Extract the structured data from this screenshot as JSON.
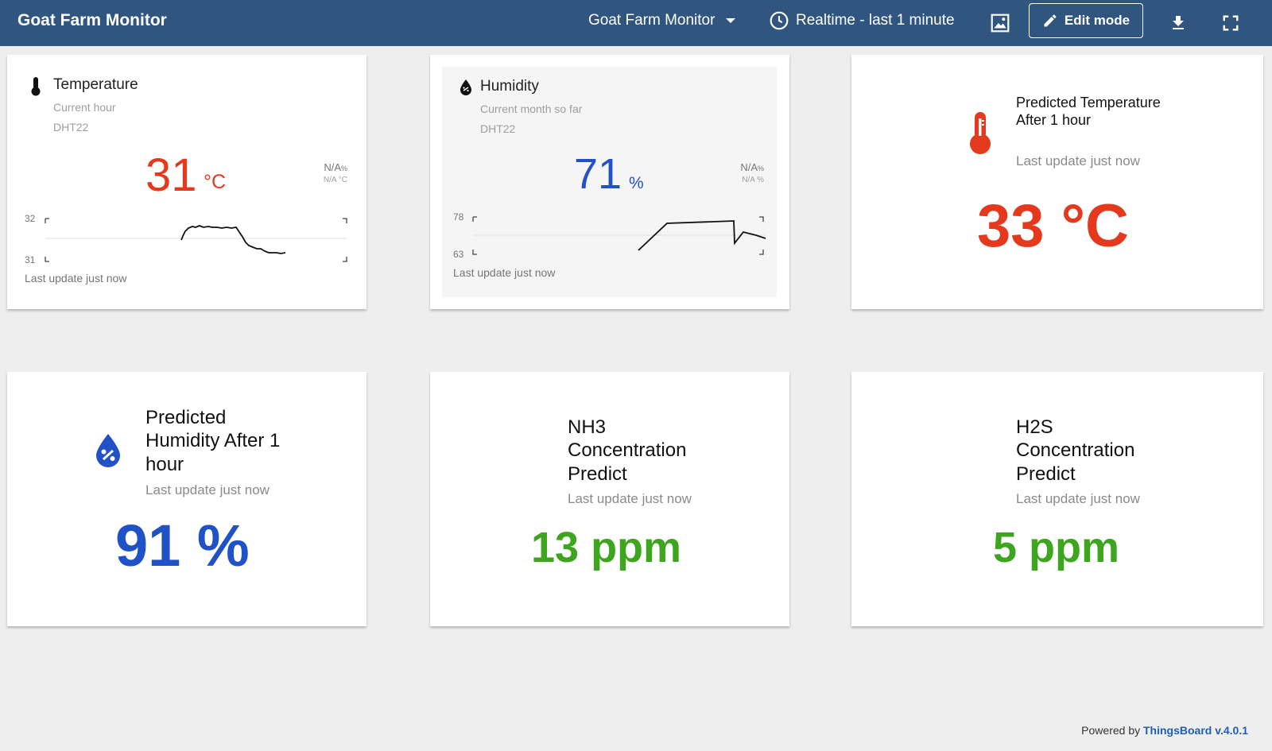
{
  "header": {
    "title": "Goat Farm Monitor",
    "dashboard_select": "Goat Farm Monitor",
    "time_window": "Realtime - last 1 minute",
    "edit_mode_label": "Edit mode",
    "icons": [
      "image-icon",
      "download-icon",
      "fullscreen-icon"
    ]
  },
  "colors": {
    "header_bg": "#305680",
    "temperature": "#e5391e",
    "humidity": "#2051c7",
    "gas": "#3ea51e"
  },
  "widgets": {
    "temperature": {
      "title": "Temperature",
      "period": "Current hour",
      "device": "DHT22",
      "value": "31",
      "unit": "°C",
      "delta_top": "N/A",
      "delta_top_unit": "%",
      "delta_bottom": "N/A °C",
      "axis_max": "32",
      "axis_min": "31",
      "last_update": "Last update just now"
    },
    "humidity": {
      "title": "Humidity",
      "period": "Current month so far",
      "device": "DHT22",
      "value": "71",
      "unit": "%",
      "delta_top": "N/A",
      "delta_top_unit": "%",
      "delta_bottom": "N/A %",
      "axis_max": "78",
      "axis_min": "63",
      "last_update": "Last update just now"
    },
    "predicted_temperature": {
      "title": "Predicted Temperature After 1 hour",
      "last_update": "Last update just now",
      "value": "33 °C"
    },
    "predicted_humidity": {
      "title": "Predicted Humidity After 1 hour",
      "last_update": "Last update just now",
      "value": "91 %"
    },
    "nh3": {
      "title": "NH3 Concentration Predict",
      "last_update": "Last update just now",
      "value": "13 ppm"
    },
    "h2s": {
      "title": "H2S Concentration Predict",
      "last_update": "Last update just now",
      "value": "5 ppm"
    }
  },
  "footer": {
    "powered_by": "Powered by",
    "brand": "ThingsBoard v.4.0.1"
  }
}
